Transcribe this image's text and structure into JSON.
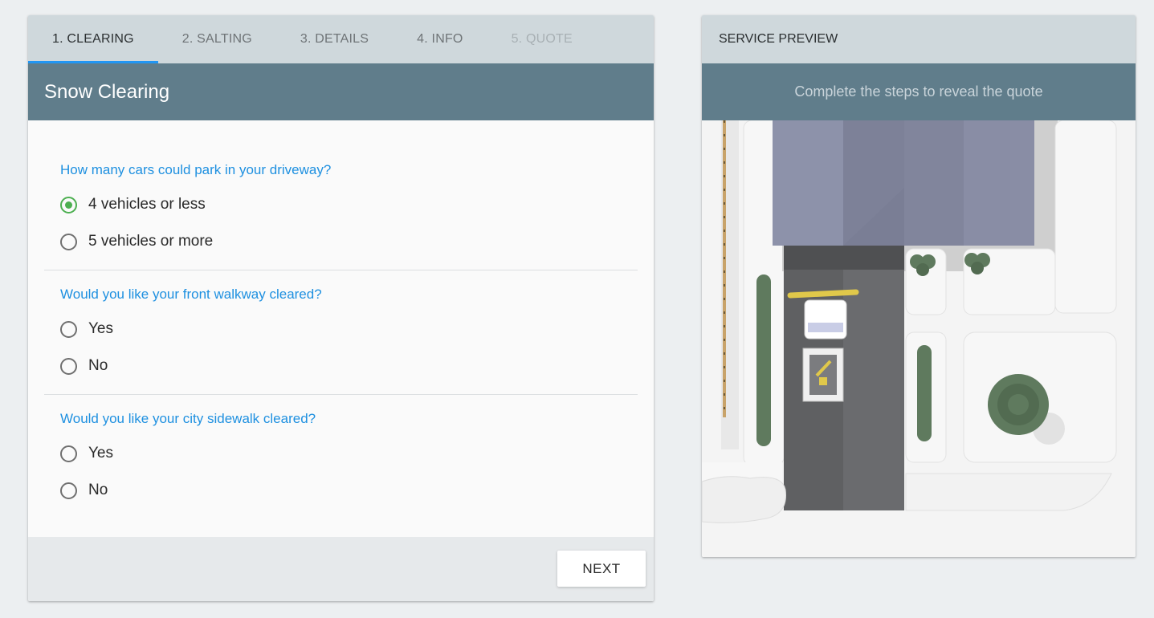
{
  "tabs": [
    {
      "label": "1. CLEARING",
      "state": "active"
    },
    {
      "label": "2. SALTING",
      "state": "normal"
    },
    {
      "label": "3. DETAILS",
      "state": "normal"
    },
    {
      "label": "4. INFO",
      "state": "normal"
    },
    {
      "label": "5. QUOTE",
      "state": "disabled"
    }
  ],
  "form": {
    "title": "Snow Clearing",
    "questions": [
      {
        "title": "How many cars could park in your driveway?",
        "options": [
          {
            "label": "4 vehicles or less",
            "checked": true
          },
          {
            "label": "5 vehicles or more",
            "checked": false
          }
        ]
      },
      {
        "title": "Would you like your front walkway cleared?",
        "options": [
          {
            "label": "Yes",
            "checked": false
          },
          {
            "label": "No",
            "checked": false
          }
        ]
      },
      {
        "title": "Would you like your city sidewalk cleared?",
        "options": [
          {
            "label": "Yes",
            "checked": false
          },
          {
            "label": "No",
            "checked": false
          }
        ]
      }
    ],
    "next_label": "NEXT"
  },
  "preview": {
    "header": "SERVICE PREVIEW",
    "message": "Complete the steps to reveal the quote",
    "scene": "house-driveway-with-plow-truck-illustration"
  },
  "colors": {
    "accent": "#2196f3",
    "banner": "#607d8b",
    "question": "#1e90e0",
    "radio_checked": "#4caf50"
  }
}
